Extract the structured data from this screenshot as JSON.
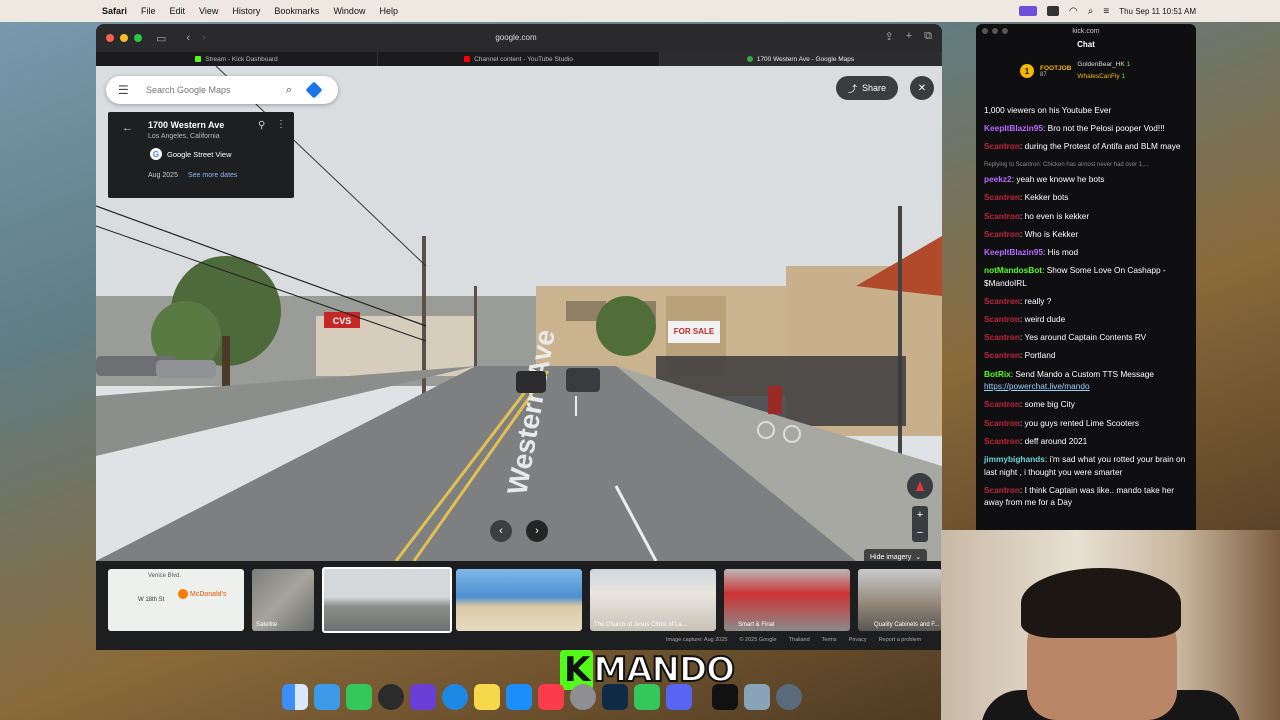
{
  "menubar": {
    "app": "Safari",
    "items": [
      "File",
      "Edit",
      "View",
      "History",
      "Bookmarks",
      "Window",
      "Help"
    ],
    "clock": "Thu Sep 11  10:51 AM"
  },
  "safari": {
    "url": "google.com",
    "tabs": [
      {
        "label": "Stream - Kick Dashboard",
        "color": "#53fc18"
      },
      {
        "label": "Channel content - YouTube Studio",
        "color": "#ff0000"
      },
      {
        "label": "1700 Western Ave - Google Maps",
        "color": "#34a853"
      }
    ]
  },
  "maps": {
    "search_placeholder": "Search Google Maps",
    "share_label": "Share",
    "place_title": "1700 Western Ave",
    "place_sub": "Los Angeles, California",
    "street_view_label": "Google Street View",
    "capture_date": "Aug 2025",
    "see_more_dates": "See more dates",
    "hide_imagery": "Hide imagery",
    "thumbs": [
      {
        "caption": "W 18th St",
        "kind": "map",
        "extra": "McDonald's",
        "extra2": "Venice Blvd."
      },
      {
        "caption": "Satellite",
        "kind": "sat"
      },
      {
        "caption": "",
        "kind": "street"
      },
      {
        "caption": "",
        "kind": "beach"
      },
      {
        "caption": "The Church of Jesus Christ of La...",
        "kind": "church"
      },
      {
        "caption": "Smart & Final",
        "kind": "store"
      },
      {
        "caption": "Quality Cabinets and F...",
        "kind": "cab"
      }
    ],
    "footer": [
      "Image capture: Aug 2025",
      "© 2025 Google",
      "Thailand",
      "Terms",
      "Privacy",
      "Report a problem"
    ]
  },
  "kick": {
    "window_title": "kick.com",
    "chat_title": "Chat",
    "top_gifter": {
      "rank": "1",
      "name": "FOOTJOB",
      "count": "87"
    },
    "leaders": [
      {
        "name": "GoldenBear_HK",
        "count": "1"
      },
      {
        "name": "WhalesCanFly",
        "count": "1"
      }
    ],
    "messages": [
      {
        "user": "",
        "color": "",
        "text": "1,000 viewers on his Youtube Ever"
      },
      {
        "user": "KeepItBlazin95",
        "color": "purple",
        "text": "Bro not the Pelosi pooper Vod!!!"
      },
      {
        "user": "Scantron",
        "color": "red",
        "text": "during the Protest of Antifa and BLM maye"
      },
      {
        "user": "peekz2",
        "color": "purple",
        "text": "yeah we knoww he bots",
        "reply": "Replying to Scantron: Chicken has almost never had over 1,..."
      },
      {
        "user": "Scantron",
        "color": "red",
        "text": "Kekker bots"
      },
      {
        "user": "Scantron",
        "color": "red",
        "text": "ho even is kekker"
      },
      {
        "user": "Scantron",
        "color": "red",
        "text": "Who is Kekker"
      },
      {
        "user": "KeepItBlazin95",
        "color": "purple",
        "text": "His mod"
      },
      {
        "user": "notMandosBot",
        "color": "green",
        "text": "Show Some Love On Cashapp - $MandoIRL"
      },
      {
        "user": "Scantron",
        "color": "red",
        "text": "really ?"
      },
      {
        "user": "Scantron",
        "color": "red",
        "text": "weird dude"
      },
      {
        "user": "Scantron",
        "color": "red",
        "text": "Yes around Captain Contents RV"
      },
      {
        "user": "Scantron",
        "color": "red",
        "text": "Portland"
      },
      {
        "user": "BotRix",
        "color": "green",
        "text": "Send Mando a Custom TTS Message",
        "link": "https://powerchat.live/mando"
      },
      {
        "user": "Scantron",
        "color": "red",
        "text": "some big City"
      },
      {
        "user": "Scantron",
        "color": "red",
        "text": "you guys rented Lime Scooters"
      },
      {
        "user": "Scantron",
        "color": "red",
        "text": "deff around 2021"
      },
      {
        "user": "jimmybighands",
        "color": "teal",
        "text": "i'm sad what you rotted your brain on last night , i thought you were smarter"
      },
      {
        "user": "Scantron",
        "color": "red",
        "text": "I think Captain was like.. mando take her away from me for a Day"
      }
    ]
  },
  "overlay": {
    "logo_k": "K",
    "logo_text": "MANDO"
  },
  "street_signs": {
    "sale": "FOR SALE",
    "cvs": "CVS",
    "road": "Western Ave"
  }
}
